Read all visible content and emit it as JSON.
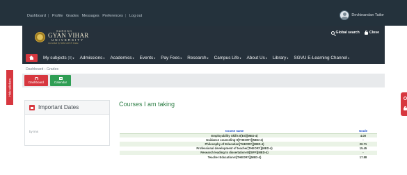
{
  "topbar": {
    "links": [
      "Dashboard",
      "Profile",
      "Grades",
      "Messages",
      "Preferences",
      "Log out"
    ],
    "separator": "|",
    "user_name": "Devkinandan Tailor"
  },
  "brand": {
    "line1": "SURESH",
    "line2": "GYAN VIHAR",
    "line3": "UNIVERSITY",
    "line4": "Accredited by NAAC with 'A' Grade",
    "search_label": "Global search",
    "close_label": "Close"
  },
  "nav": {
    "my_subjects": "My subjects",
    "my_subjects_badge": "(0)",
    "items": [
      "Admissions",
      "Academics",
      "Events",
      "Pay Fees",
      "Research",
      "Campus Life",
      "About Us",
      "Library",
      "SGVU E-Learning Channel"
    ]
  },
  "breadcrumb": {
    "items": [
      "Dashboard",
      "Grades"
    ],
    "separator": "›"
  },
  "side_tab": {
    "label": "Hide sidebars"
  },
  "toolbar": {
    "dashboard_label": "Dashboard",
    "calendar_label": "Calendar"
  },
  "important_dates": {
    "title": "Important Dates",
    "body": "by ims"
  },
  "courses": {
    "title": "Courses I am taking",
    "headers": {
      "name": "Course name",
      "grade": "Grade"
    },
    "rows": [
      {
        "name": "Employability Skills II[ES](MED-4)",
        "grade": "4.00"
      },
      {
        "name": "Guidance counseling-II[THEORY](MED-4)",
        "grade": "-"
      },
      {
        "name": "Philosophy of Education[THEORY](MED-4)",
        "grade": "20.71"
      },
      {
        "name": "Professional development of teacher[THEORY](MED-4)",
        "grade": "15.45"
      },
      {
        "name": "Research leading to dissertation-III[DIFF](MED-4)",
        "grade": "-"
      },
      {
        "name": "Teacher Education-II[THEORY](MED-4)",
        "grade": "17.88"
      }
    ]
  },
  "colors": {
    "accent_red": "#d7373f",
    "accent_green": "#2f9e54",
    "header_dark": "#24323c"
  }
}
